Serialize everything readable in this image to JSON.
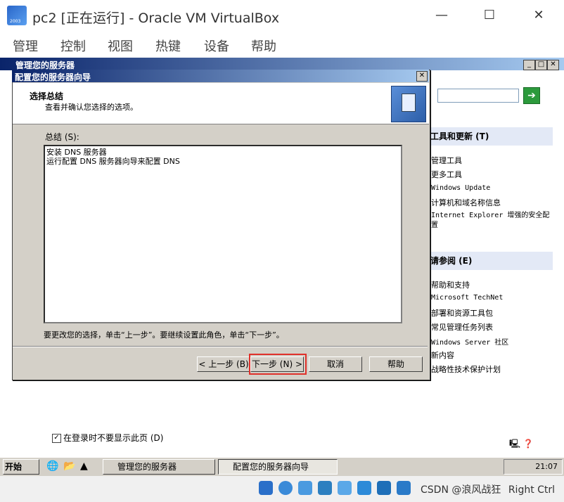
{
  "host": {
    "title": "pc2 [正在运行] - Oracle VM VirtualBox",
    "icon_year": "2003",
    "controls": {
      "minimize": "—",
      "maximize": "☐",
      "close": "✕"
    },
    "menu": [
      "管理",
      "控制",
      "视图",
      "热键",
      "设备",
      "帮助"
    ],
    "status_text": "CSDN @浪风战狂",
    "host_key": "Right Ctrl"
  },
  "manager_window": {
    "title": "管理您的服务器",
    "controls": {
      "minimize": "_",
      "maximize": "□",
      "close": "✕"
    },
    "right_panel": {
      "go_arrow": "➔",
      "section1": {
        "heading": "工具和更新 (T)",
        "links": [
          "管理工具",
          "更多工具",
          "Windows Update",
          "计算机和域名称信息",
          "Internet Explorer 增强的安全配置"
        ]
      },
      "section2": {
        "heading": "请参阅 (E)",
        "links": [
          "帮助和支持",
          "Microsoft TechNet",
          "部署和资源工具包",
          "常见管理任务列表",
          "Windows Server 社区",
          "新内容",
          "战略性技术保护计划"
        ]
      }
    },
    "checkbox_label": "在登录时不要显示此页 (D)",
    "checkbox_checked": true,
    "checkbox_mark": "✓"
  },
  "dialog": {
    "title": "配置您的服务器向导",
    "close": "✕",
    "header_title": "选择总结",
    "header_subtitle": "查看并确认您选择的选项。",
    "summary_label": "总结 (S):",
    "summary_lines": [
      "安装 DNS 服务器",
      "运行配置 DNS 服务器向导来配置 DNS"
    ],
    "hint": "要更改您的选择，单击“上一步”。要继续设置此角色，单击“下一步”。",
    "buttons": {
      "back": "< 上一步 (B)",
      "next": "下一步 (N) >",
      "cancel": "取消",
      "help": "帮助"
    }
  },
  "taskbar": {
    "start": "开始",
    "items": [
      "管理您的服务器",
      "配置您的服务器向导"
    ],
    "clock": "21:07"
  },
  "colors": {
    "title_gradient_start": "#0a246a",
    "title_gradient_end": "#a6caf0",
    "highlight": "#e0302a",
    "dialog_bg": "#d4d0c8"
  }
}
